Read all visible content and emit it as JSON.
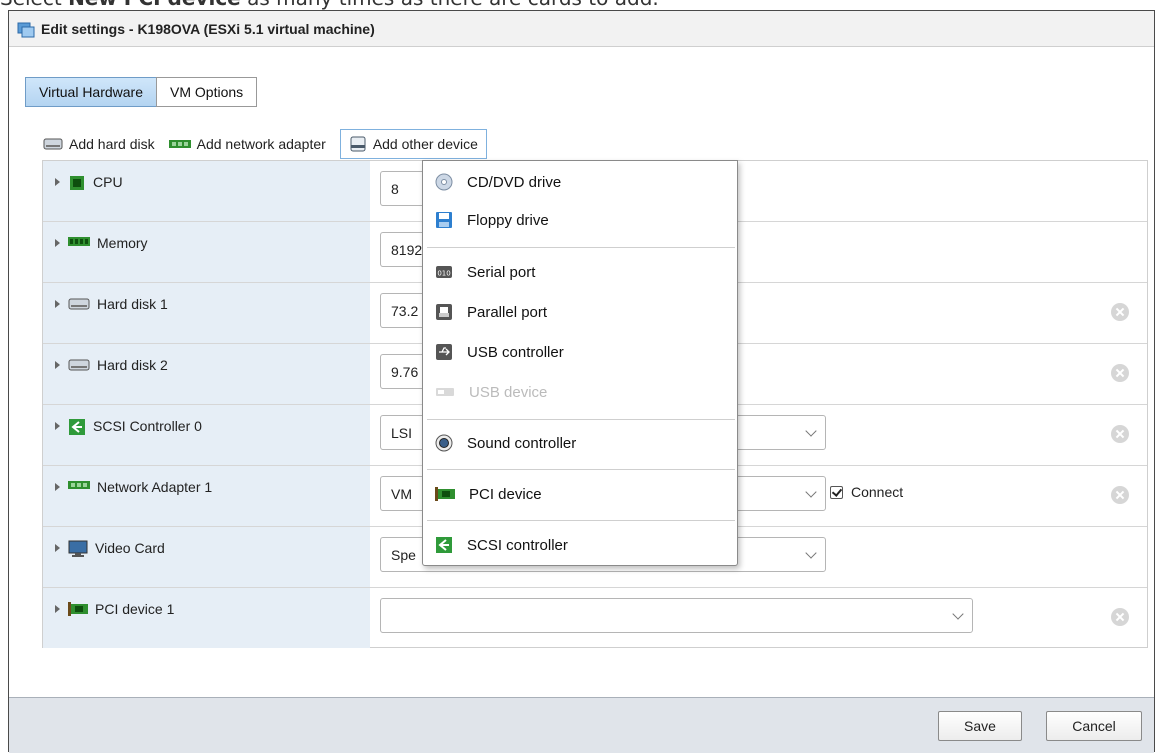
{
  "doc_caption": {
    "prefix": "Select",
    "bold": "New PCI device",
    "suffix": "as many times as there are cards to add."
  },
  "dialog": {
    "title": "Edit settings - K198OVA (ESXi 5.1 virtual machine)"
  },
  "tabs": [
    {
      "label": "Virtual Hardware",
      "active": true
    },
    {
      "label": "VM Options",
      "active": false
    }
  ],
  "toolbar": {
    "add_hard_disk": "Add hard disk",
    "add_network_adapter": "Add network adapter",
    "add_other_device": "Add other device"
  },
  "hardware_rows": [
    {
      "label": "CPU",
      "icon": "cpu-icon",
      "value": "8"
    },
    {
      "label": "Memory",
      "icon": "memory-icon",
      "value": "8192"
    },
    {
      "label": "Hard disk 1",
      "icon": "hard-disk-icon",
      "value": "73.2"
    },
    {
      "label": "Hard disk 2",
      "icon": "hard-disk-icon",
      "value": "9.76"
    },
    {
      "label": "SCSI Controller 0",
      "icon": "scsi-controller-icon",
      "value": "LSI"
    },
    {
      "label": "Network Adapter 1",
      "icon": "network-adapter-icon",
      "value": "VM",
      "connect_label": "Connect",
      "connect_checked": true
    },
    {
      "label": "Video Card",
      "icon": "video-card-icon",
      "value": "Spe"
    },
    {
      "label": "PCI device 1",
      "icon": "pci-device-icon",
      "value": ""
    }
  ],
  "add_device_menu": [
    {
      "label": "CD/DVD drive",
      "icon": "cd-dvd-icon",
      "enabled": true
    },
    {
      "label": "Floppy drive",
      "icon": "floppy-icon",
      "enabled": true
    },
    {
      "label": "Serial port",
      "icon": "serial-port-icon",
      "enabled": true
    },
    {
      "label": "Parallel port",
      "icon": "parallel-port-icon",
      "enabled": true
    },
    {
      "label": "USB controller",
      "icon": "usb-controller-icon",
      "enabled": true
    },
    {
      "label": "USB device",
      "icon": "usb-device-icon",
      "enabled": false
    },
    {
      "label": "Sound controller",
      "icon": "sound-icon",
      "enabled": true
    },
    {
      "label": "PCI device",
      "icon": "pci-device-icon",
      "enabled": true
    },
    {
      "label": "SCSI controller",
      "icon": "scsi-controller-icon",
      "enabled": true
    }
  ],
  "footer": {
    "save_label": "Save",
    "cancel_label": "Cancel"
  },
  "colors": {
    "accent_tab": "#b4d4f1",
    "label_column": "#e6eef6",
    "footer": "#e0e4ea"
  }
}
